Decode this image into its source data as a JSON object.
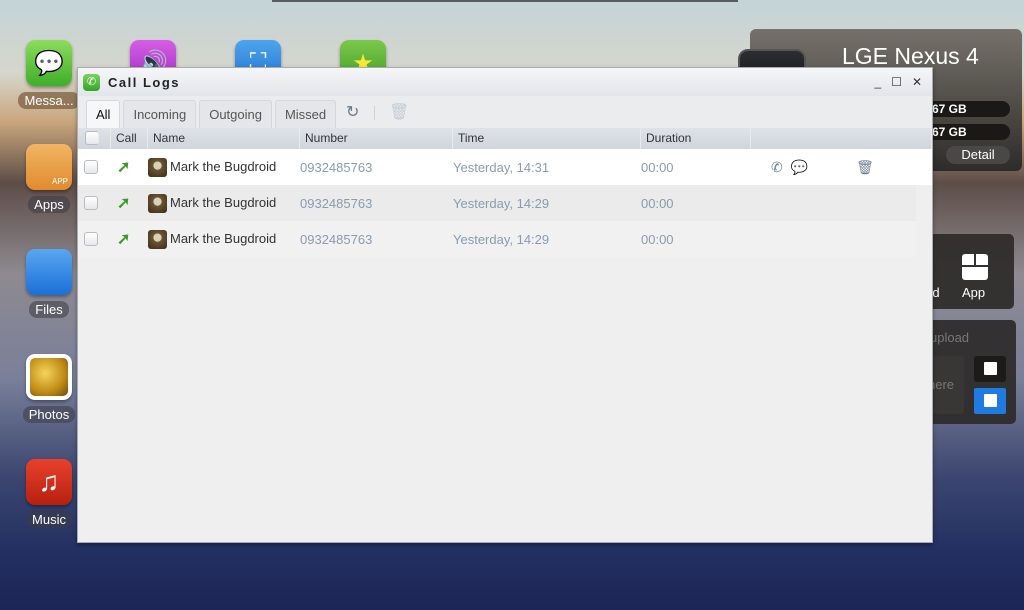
{
  "desktop": {
    "icons": [
      {
        "label": "Messa...",
        "icon": "message-bubble-icon"
      },
      {
        "label": "Apps",
        "icon": "package-box-icon"
      },
      {
        "label": "Files",
        "icon": "folder-icon"
      },
      {
        "label": "Photos",
        "icon": "photo-icon"
      },
      {
        "label": "Music",
        "icon": "music-note-icon"
      }
    ],
    "top_icons": [
      "speaker-icon",
      "crop-icon",
      "star-icon"
    ]
  },
  "device": {
    "name": "LGE Nexus 4",
    "storage_1": "67 GB",
    "storage_2": "67 GB",
    "detail_label": "Detail"
  },
  "side_panels": {
    "app_panel_label_partial": "rd",
    "app_label": "App",
    "upload_label": "upload",
    "drop_hint": "here"
  },
  "window": {
    "title": "Call Logs",
    "controls": {
      "minimize": "_",
      "maximize": "☐",
      "close": "✕"
    },
    "tabs": [
      {
        "label": "All",
        "active": true
      },
      {
        "label": "Incoming",
        "active": false
      },
      {
        "label": "Outgoing",
        "active": false
      },
      {
        "label": "Missed",
        "active": false
      }
    ],
    "columns": [
      "Call",
      "Name",
      "Number",
      "Time",
      "Duration"
    ],
    "rows": [
      {
        "call_type": "outgoing",
        "name": "Mark the Bugdroid",
        "number": "0932485763",
        "time": "Yesterday, 14:31",
        "duration": "00:00"
      },
      {
        "call_type": "outgoing",
        "name": "Mark the Bugdroid",
        "number": "0932485763",
        "time": "Yesterday, 14:29",
        "duration": "00:00"
      },
      {
        "call_type": "outgoing",
        "name": "Mark the Bugdroid",
        "number": "0932485763",
        "time": "Yesterday, 14:29",
        "duration": "00:00"
      }
    ]
  },
  "colors": {
    "accent_green": "#3d9b2a",
    "link_gray_blue": "#8a9bb0",
    "upload_blue": "#1f7be0"
  }
}
